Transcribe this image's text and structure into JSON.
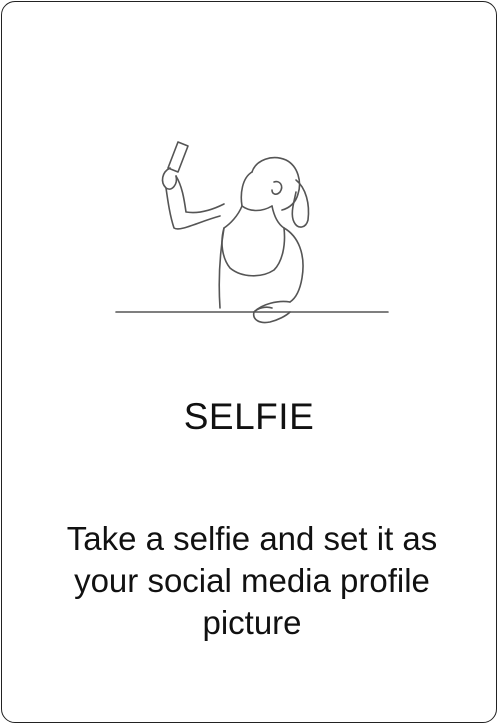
{
  "card": {
    "title": "SELFIE",
    "description": "Take a selfie and set it as your social media profile picture",
    "illustration_icon": "selfie-line-art-icon"
  },
  "colors": {
    "border": "#222222",
    "text": "#111111",
    "line_art": "#555555",
    "background": "#ffffff"
  }
}
